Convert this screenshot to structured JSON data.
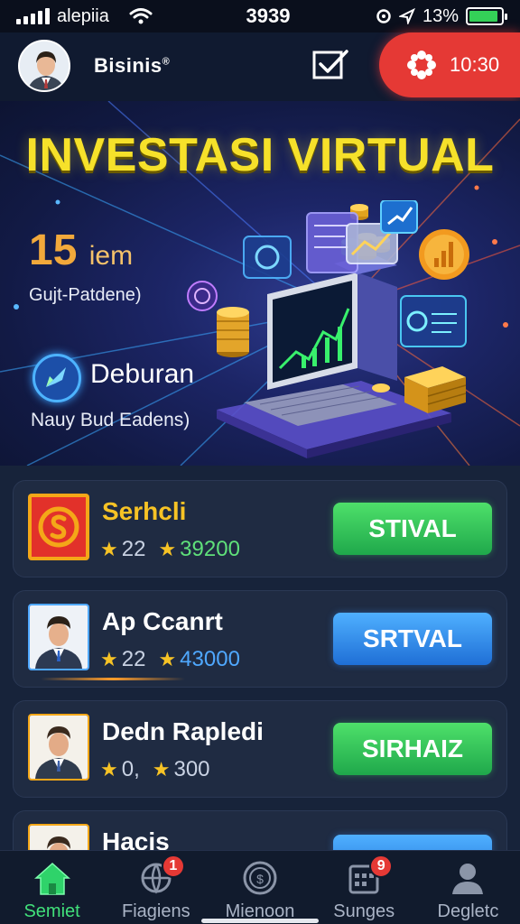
{
  "status_bar": {
    "carrier": "alepiia",
    "time": "3939",
    "battery": "13%",
    "battery_level": 0.9
  },
  "header": {
    "app_name": "Bisinis",
    "app_name_mark": "®",
    "timer": "10:30"
  },
  "banner": {
    "title": "INVESTASI VIRTUAL",
    "stat_number": "15",
    "stat_unit": "iem",
    "stat_sub": "Gujt-Patdene)",
    "feature_title": "Deburan",
    "feature_sub": "Nauy Bud Eadens)"
  },
  "list": [
    {
      "name": "Serhcli",
      "stat1": "22",
      "stat2": "39200",
      "stat2_color": "#5fe07a",
      "action": "STIVAL",
      "action_style": "green",
      "thumb": "logo"
    },
    {
      "name": "Ap Ccanrt",
      "stat1": "22",
      "stat2": "43000",
      "stat2_color": "#4fa8ff",
      "action": "SRTVAL",
      "action_style": "blue",
      "thumb": "person"
    },
    {
      "name": "Dedn Rapledi",
      "stat1": "0,",
      "stat2": "300",
      "stat2_color": "#c9d2e3",
      "action": "SIRHAIZ",
      "action_style": "green",
      "thumb": "person"
    },
    {
      "name": "Hacis",
      "stat1": "",
      "stat2": "",
      "stat2_color": "#c9d2e3",
      "action": "",
      "action_style": "blue",
      "thumb": "person"
    }
  ],
  "nav": [
    {
      "label": "Semiet",
      "icon": "home-icon",
      "active": true,
      "badge": ""
    },
    {
      "label": "Fiagiens",
      "icon": "globe-icon",
      "active": false,
      "badge": "1"
    },
    {
      "label": "Mienoon",
      "icon": "coin-icon",
      "active": false,
      "badge": ""
    },
    {
      "label": "Sunges",
      "icon": "calendar-icon",
      "active": false,
      "badge": "9"
    },
    {
      "label": "Degletc",
      "icon": "user-icon",
      "active": false,
      "badge": ""
    }
  ],
  "colors": {
    "accent_green": "#41e07a",
    "accent_red": "#e53935",
    "title_yellow": "#f6e12a"
  }
}
